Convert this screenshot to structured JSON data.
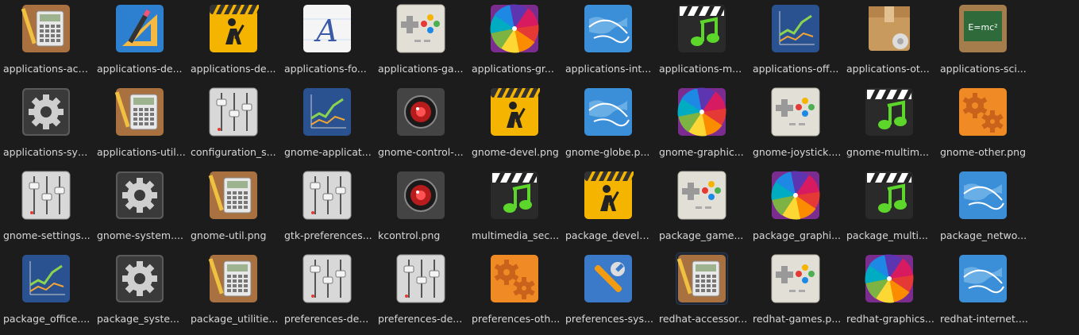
{
  "files": [
    {
      "label": "applications-acc...",
      "icon": "calculator-icon"
    },
    {
      "label": "applications-de...",
      "icon": "design-tools-icon"
    },
    {
      "label": "applications-de...",
      "icon": "construction-worker-icon"
    },
    {
      "label": "applications-fo...",
      "icon": "font-icon"
    },
    {
      "label": "applications-ga...",
      "icon": "gamepad-icon"
    },
    {
      "label": "applications-gr...",
      "icon": "color-wheel-icon"
    },
    {
      "label": "applications-int...",
      "icon": "globe-icon"
    },
    {
      "label": "applications-m...",
      "icon": "music-clapper-icon"
    },
    {
      "label": "applications-off...",
      "icon": "chart-icon"
    },
    {
      "label": "applications-ot...",
      "icon": "package-box-icon"
    },
    {
      "label": "applications-sci...",
      "icon": "chalkboard-icon"
    },
    {
      "label": "applications-sys...",
      "icon": "gear-icon"
    },
    {
      "label": "applications-util...",
      "icon": "calculator-icon"
    },
    {
      "label": "configuration_s...",
      "icon": "sliders-icon"
    },
    {
      "label": "gnome-applicat...",
      "icon": "chart-icon"
    },
    {
      "label": "gnome-control-...",
      "icon": "red-eye-icon"
    },
    {
      "label": "gnome-devel.png",
      "icon": "construction-worker-icon"
    },
    {
      "label": "gnome-globe.p...",
      "icon": "globe-icon"
    },
    {
      "label": "gnome-graphic...",
      "icon": "color-wheel-icon"
    },
    {
      "label": "gnome-joystick....",
      "icon": "gamepad-icon"
    },
    {
      "label": "gnome-multim...",
      "icon": "music-clapper-icon"
    },
    {
      "label": "gnome-other.png",
      "icon": "orange-gears-icon"
    },
    {
      "label": "gnome-settings...",
      "icon": "sliders-icon"
    },
    {
      "label": "gnome-system....",
      "icon": "gear-icon"
    },
    {
      "label": "gnome-util.png",
      "icon": "calculator-icon"
    },
    {
      "label": "gtk-preferences...",
      "icon": "sliders-icon"
    },
    {
      "label": "kcontrol.png",
      "icon": "red-eye-icon"
    },
    {
      "label": "multimedia_sec...",
      "icon": "music-clapper-icon"
    },
    {
      "label": "package_develo...",
      "icon": "construction-worker-icon"
    },
    {
      "label": "package_game...",
      "icon": "gamepad-icon"
    },
    {
      "label": "package_graphi...",
      "icon": "color-wheel-icon"
    },
    {
      "label": "package_multi...",
      "icon": "music-clapper-icon"
    },
    {
      "label": "package_netwo...",
      "icon": "globe-icon"
    },
    {
      "label": "package_office....",
      "icon": "chart-icon"
    },
    {
      "label": "package_syste...",
      "icon": "gear-icon"
    },
    {
      "label": "package_utilitie...",
      "icon": "calculator-icon"
    },
    {
      "label": "preferences-de...",
      "icon": "sliders-icon"
    },
    {
      "label": "preferences-de...",
      "icon": "sliders-icon"
    },
    {
      "label": "preferences-oth...",
      "icon": "orange-gears-icon"
    },
    {
      "label": "preferences-sys...",
      "icon": "wrench-icon"
    },
    {
      "label": "redhat-accessor...",
      "icon": "calculator-icon",
      "selected": true
    },
    {
      "label": "redhat-games.p...",
      "icon": "gamepad-icon"
    },
    {
      "label": "redhat-graphics...",
      "icon": "color-wheel-icon"
    },
    {
      "label": "redhat-internet....",
      "icon": "globe-icon"
    }
  ]
}
